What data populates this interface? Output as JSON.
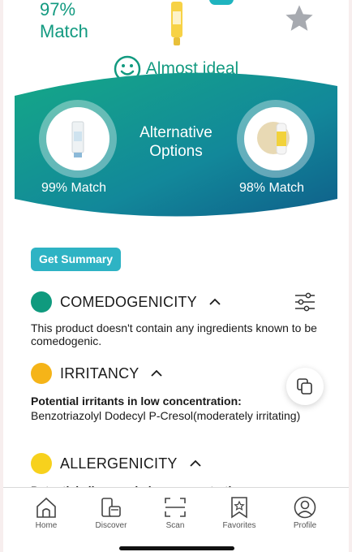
{
  "product": {
    "match_label": "97%\nMatch",
    "match_line1": "97%",
    "match_line2": "Match",
    "status": "Almost ideal"
  },
  "alternatives": {
    "title_line1": "Alternative",
    "title_line2": "Options",
    "left_match": "99% Match",
    "right_match": "98% Match"
  },
  "summary_button": "Get Summary",
  "sections": {
    "comedogenicity": {
      "title": "COMEDOGENICITY",
      "color": "#0f9a7e",
      "text": "This product doesn't contain any ingredients known to be comedogenic."
    },
    "irritancy": {
      "title": "IRRITANCY",
      "color": "#f5b418",
      "heading": "Potential irritants in low concentration:",
      "text": "Benzotriazolyl Dodecyl P-Cresol(moderately irritating)"
    },
    "allergenicity": {
      "title": "ALLERGENICITY",
      "color": "#f7d11d",
      "cut_text": "Potential allergens in low concentration:"
    }
  },
  "tabs": [
    {
      "label": "Home",
      "icon": "home-icon"
    },
    {
      "label": "Discover",
      "icon": "discover-icon"
    },
    {
      "label": "Scan",
      "icon": "scan-icon"
    },
    {
      "label": "Favorites",
      "icon": "favorites-icon"
    },
    {
      "label": "Profile",
      "icon": "profile-icon"
    }
  ],
  "colors": {
    "accent": "#129a80",
    "wave_start": "#15a887",
    "wave_end": "#0f5f8a",
    "button": "#2eb3c4"
  }
}
